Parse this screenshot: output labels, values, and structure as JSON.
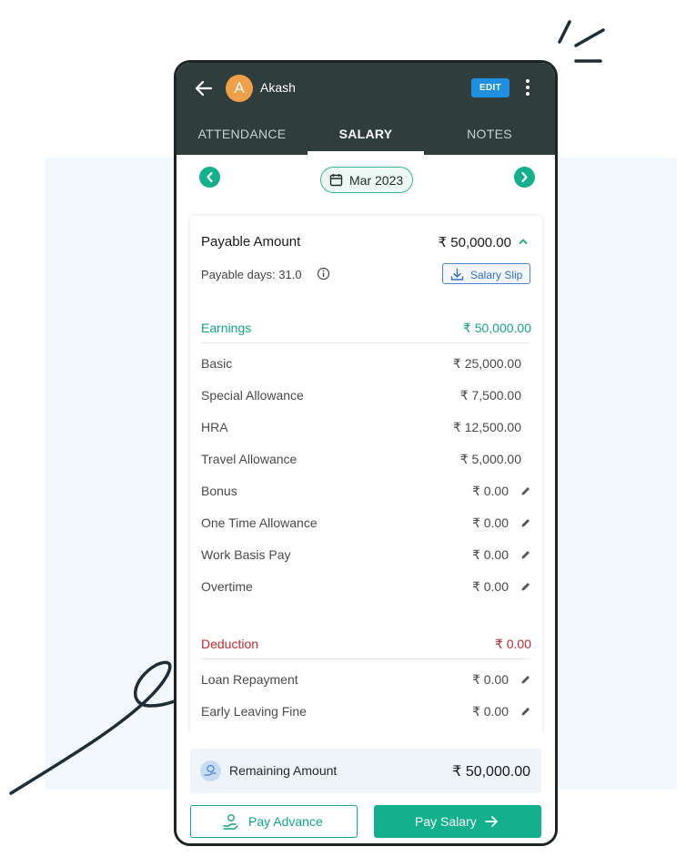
{
  "header": {
    "avatar_initial": "A",
    "user_name": "Akash",
    "edit_label": "EDIT"
  },
  "tabs": [
    {
      "label": "ATTENDANCE",
      "active": false
    },
    {
      "label": "SALARY",
      "active": true
    },
    {
      "label": "NOTES",
      "active": false
    }
  ],
  "month": "Mar 2023",
  "payable": {
    "title": "Payable Amount",
    "amount": "₹ 50,000.00",
    "days_label": "Payable days: 31.0",
    "salary_slip_label": "Salary Slip"
  },
  "earnings": {
    "title": "Earnings",
    "total": "₹ 50,000.00",
    "rows": [
      {
        "label": "Basic",
        "value": "₹ 25,000.00",
        "editable": false
      },
      {
        "label": "Special Allowance",
        "value": "₹ 7,500.00",
        "editable": false
      },
      {
        "label": "HRA",
        "value": "₹ 12,500.00",
        "editable": false
      },
      {
        "label": "Travel Allowance",
        "value": "₹ 5,000.00",
        "editable": false
      },
      {
        "label": "Bonus",
        "value": "₹ 0.00",
        "editable": true
      },
      {
        "label": "One Time Allowance",
        "value": "₹ 0.00",
        "editable": true
      },
      {
        "label": "Work Basis Pay",
        "value": "₹ 0.00",
        "editable": true
      },
      {
        "label": "Overtime",
        "value": "₹ 0.00",
        "editable": true
      }
    ]
  },
  "deduction": {
    "title": "Deduction",
    "total": "₹ 0.00",
    "rows": [
      {
        "label": "Loan Repayment",
        "value": "₹ 0.00",
        "editable": true
      },
      {
        "label": "Early Leaving Fine",
        "value": "₹ 0.00",
        "editable": true
      }
    ]
  },
  "footer": {
    "remaining_label": "Remaining Amount",
    "remaining_amount": "₹ 50,000.00",
    "pay_advance_label": "Pay Advance",
    "pay_salary_label": "Pay Salary"
  },
  "colors": {
    "header_bg": "#2f3d3d",
    "accent_green": "#12b08d",
    "edit_blue": "#1d90e0",
    "deduction_red": "#c0292f",
    "avatar_orange": "#f1a04a"
  }
}
